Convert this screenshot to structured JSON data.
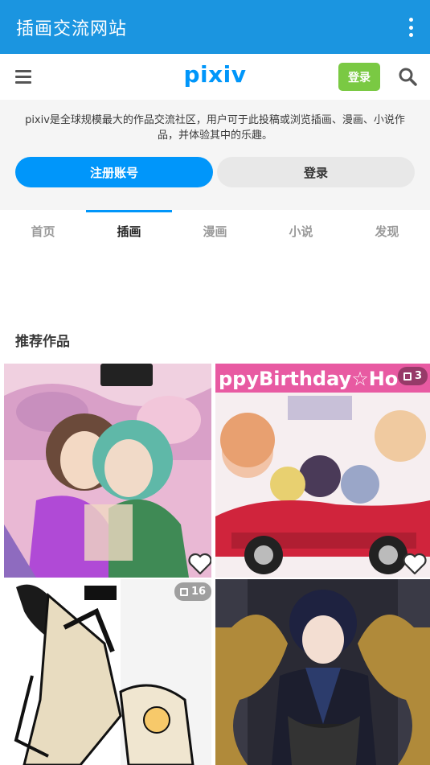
{
  "appbar": {
    "title": "插画交流网站",
    "menu_icon": "more-vert-icon"
  },
  "header": {
    "logo": "pixiv",
    "login_label": "登录",
    "menu_icon": "hamburger-icon",
    "search_icon": "search-icon"
  },
  "promo": {
    "description": "pixiv是全球规模最大的作品交流社区，用户可于此投稿或浏览插画、漫画、小说作品，并体验其中的乐趣。",
    "register_label": "注册账号",
    "login_label": "登录"
  },
  "tabs": [
    {
      "label": "首页",
      "active": false
    },
    {
      "label": "插画",
      "active": true
    },
    {
      "label": "漫画",
      "active": false
    },
    {
      "label": "小说",
      "active": false
    },
    {
      "label": "发现",
      "active": false
    }
  ],
  "recommended": {
    "title": "推荐作品",
    "items": [
      {
        "page_count": null
      },
      {
        "page_count": "3",
        "banner_text": "ppyBirthday☆Ho"
      },
      {
        "page_count": "16"
      },
      {
        "page_count": null
      }
    ]
  },
  "colors": {
    "appbar": "#1b95e0",
    "accent": "#0096fa",
    "login_green": "#7ac943"
  }
}
